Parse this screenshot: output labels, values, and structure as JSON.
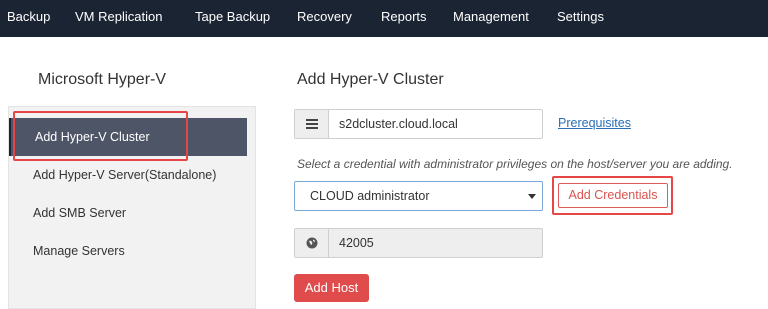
{
  "topnav": {
    "items": [
      {
        "label": "Backup"
      },
      {
        "label": "VM Replication"
      },
      {
        "label": "Tape Backup"
      },
      {
        "label": "Recovery"
      },
      {
        "label": "Reports"
      },
      {
        "label": "Management"
      },
      {
        "label": "Settings"
      }
    ]
  },
  "sidebar": {
    "title": "Microsoft Hyper-V",
    "items": [
      {
        "label": "Add Hyper-V Cluster",
        "active": true
      },
      {
        "label": "Add Hyper-V Server(Standalone)"
      },
      {
        "label": "Add SMB Server"
      },
      {
        "label": "Manage Servers"
      }
    ]
  },
  "main": {
    "title": "Add Hyper-V Cluster",
    "host": {
      "value": "s2dcluster.cloud.local",
      "icon": "server-icon"
    },
    "prerequisites_link": "Prerequisites",
    "credential_hint": "Select a credential with administrator privileges on the host/server you are adding.",
    "credential_select": {
      "selected": "CLOUD administrator"
    },
    "add_credentials_label": "Add Credentials",
    "port": {
      "value": "42005",
      "icon": "globe-icon"
    },
    "add_host_label": "Add Host"
  },
  "colors": {
    "nav_bg": "#1b2433",
    "accent_red": "#e04c4c",
    "active_item_bg": "#4e5566",
    "link_blue": "#2a6fb6"
  }
}
